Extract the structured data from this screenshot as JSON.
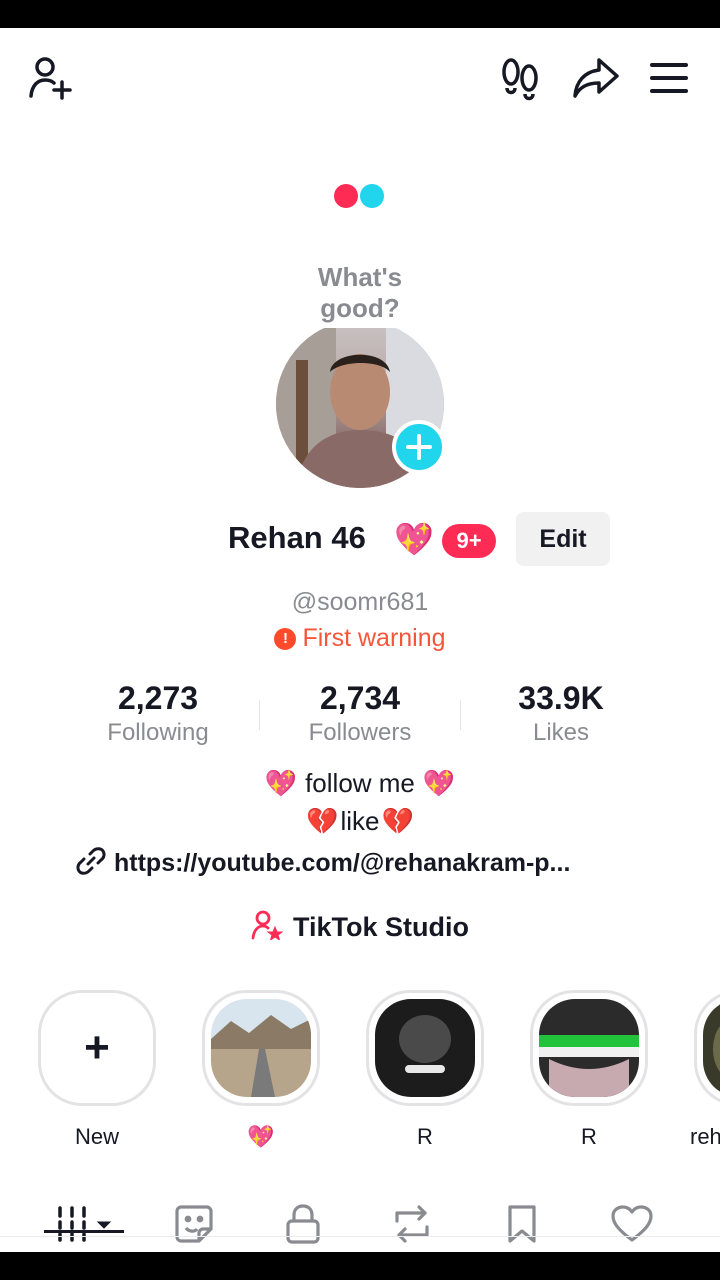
{
  "colors": {
    "brand_red": "#fe2c55",
    "brand_cyan": "#20d5ec",
    "warning": "#f5563a",
    "text_primary": "#161823",
    "text_secondary": "#8a8b91"
  },
  "header": {
    "icons": [
      "add-friend-icon",
      "footprints-icon",
      "share-icon",
      "menu-icon"
    ]
  },
  "note": {
    "text": "What's good?"
  },
  "profile": {
    "display_name": "Rehan 46",
    "name_emoji": "💖",
    "notification_badge": "9+",
    "edit_label": "Edit",
    "handle": "@soomr681",
    "warning_icon": "!",
    "warning_text": "First warning"
  },
  "stats": [
    {
      "value": "2,273",
      "label": "Following"
    },
    {
      "value": "2,734",
      "label": "Followers"
    },
    {
      "value": "33.9K",
      "label": "Likes"
    }
  ],
  "bio": {
    "line1_prefix": "💖",
    "line1_text": "follow me",
    "line1_suffix": "💖",
    "line2_prefix": "💔",
    "line2_text": "like",
    "line2_suffix": "💔",
    "link": "https://youtube.com/@rehanakram-p..."
  },
  "studio": {
    "label": "TikTok Studio"
  },
  "highlights": [
    {
      "label": "New",
      "symbol": "+"
    },
    {
      "label": "💖"
    },
    {
      "label": "R"
    },
    {
      "label": "R"
    },
    {
      "label": "reh"
    }
  ],
  "tabs": [
    "videos-grid-tab",
    "reposts-sticker-tab",
    "private-lock-tab",
    "repost-tab",
    "saved-bookmark-tab",
    "liked-heart-tab"
  ]
}
